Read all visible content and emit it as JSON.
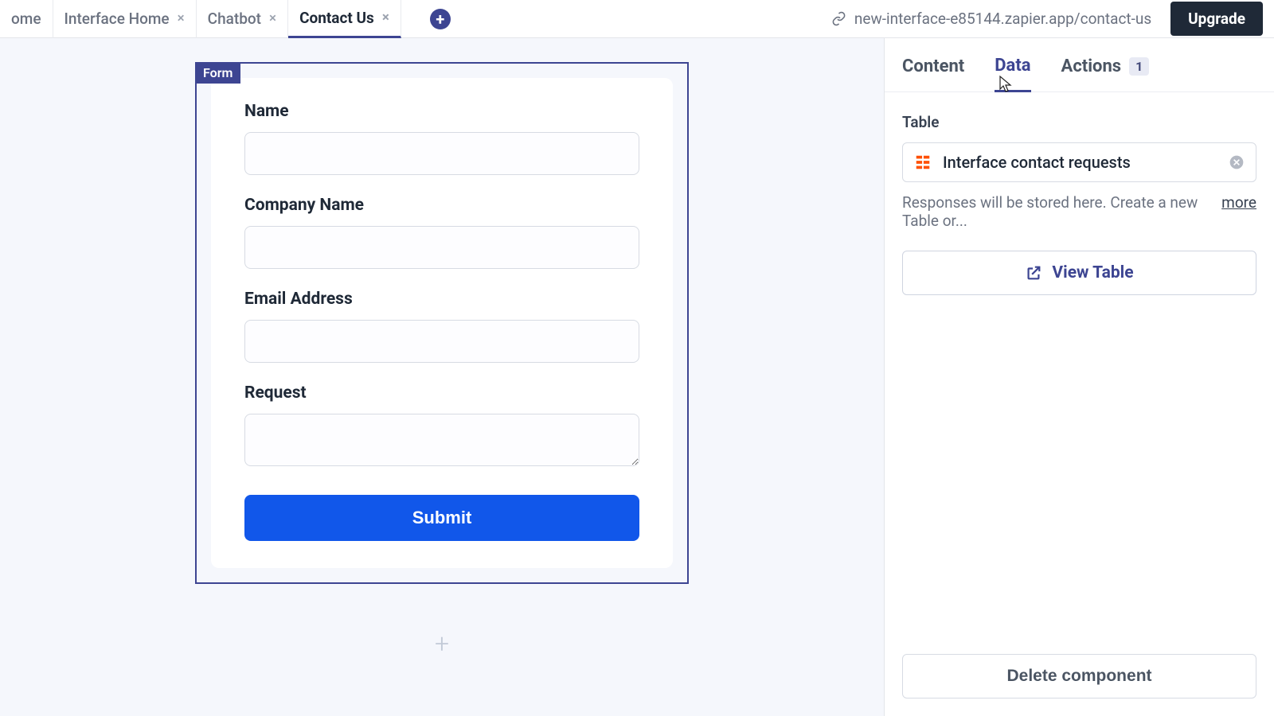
{
  "topbar": {
    "tabs": [
      {
        "label": "ome",
        "closable": false,
        "partial": true
      },
      {
        "label": "Interface Home",
        "closable": true
      },
      {
        "label": "Chatbot",
        "closable": true
      },
      {
        "label": "Contact Us",
        "closable": true,
        "active": true
      }
    ],
    "url": "new-interface-e85144.zapier.app/contact-us",
    "upgrade": "Upgrade"
  },
  "form": {
    "tag": "Form",
    "fields": {
      "name": {
        "label": "Name"
      },
      "company": {
        "label": "Company Name"
      },
      "email": {
        "label": "Email Address"
      },
      "request": {
        "label": "Request"
      }
    },
    "submit": "Submit"
  },
  "panel": {
    "tabs": {
      "content": "Content",
      "data": "Data",
      "actions": {
        "label": "Actions",
        "badge": "1"
      }
    },
    "section_label": "Table",
    "table_name": "Interface contact requests",
    "help_text": "Responses will be stored here. Create a new Table or...",
    "more": "more",
    "view_table": "View Table",
    "delete": "Delete component"
  }
}
